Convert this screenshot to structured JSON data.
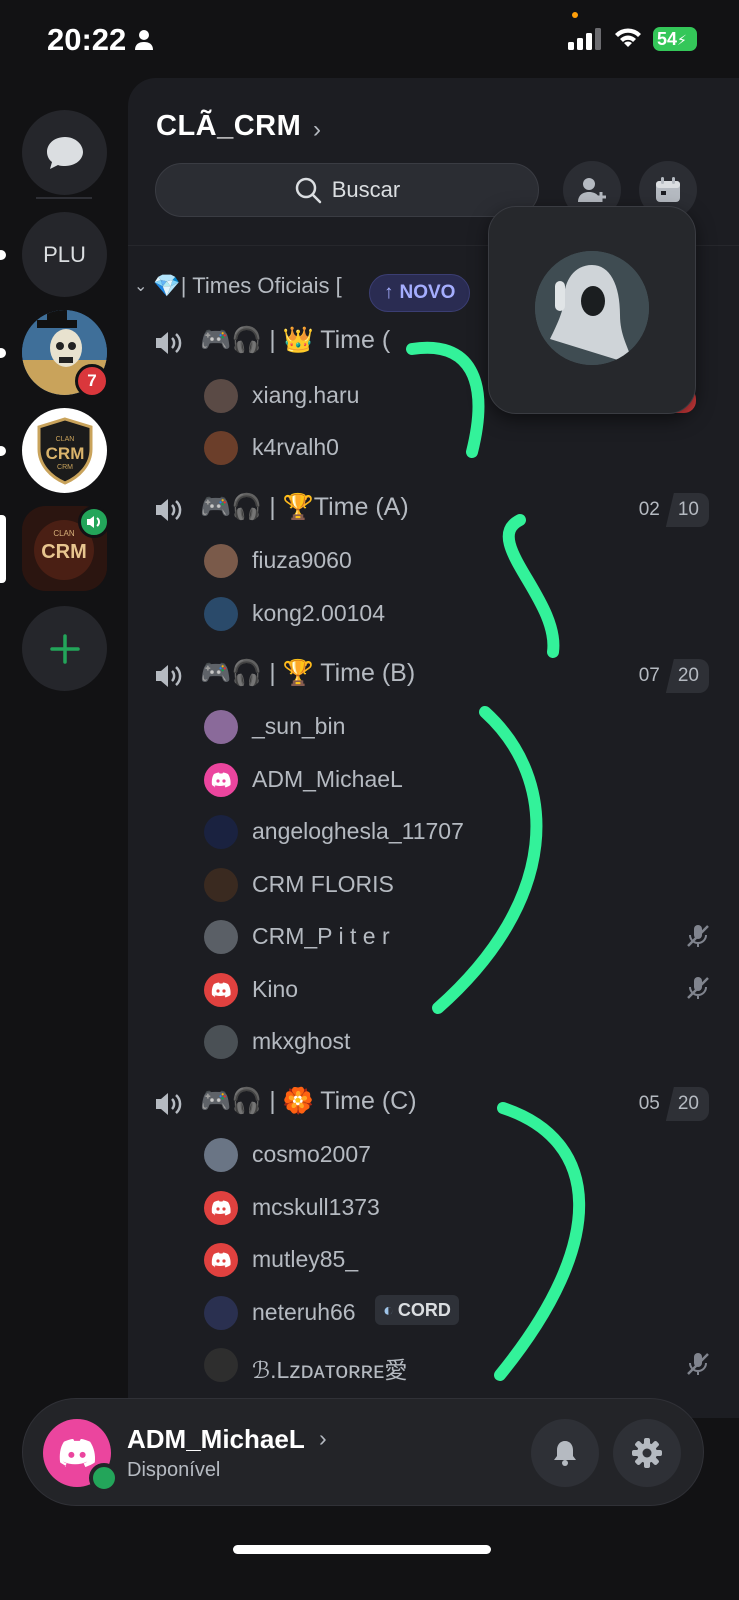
{
  "status_bar": {
    "time": "20:22",
    "battery": "54"
  },
  "rail": {
    "dm_label": "",
    "servers": [
      {
        "abbr": "PLU"
      },
      {
        "badge": "7"
      },
      {
        "logo_top": "CLAN",
        "logo_main": "CRM",
        "logo_bottom": "CRM"
      },
      {
        "logo_top": "CLAN",
        "logo_main": "CRM"
      }
    ]
  },
  "header": {
    "guild_name": "CLÃ_CRM",
    "search_placeholder": "Buscar"
  },
  "category": {
    "label": "💎| Times Oficiais [",
    "new_pill": "NOVO"
  },
  "channels": [
    {
      "label": "🎮🎧 | 👑 Time (",
      "users": [
        {
          "name": "xiang.haru"
        },
        {
          "name": "k4rvalh0"
        }
      ]
    },
    {
      "label": "🎮🎧 | 🏆Time (A)",
      "count": "02",
      "limit": "10",
      "users": [
        {
          "name": "fiuza9060"
        },
        {
          "name": "kong2.00104"
        }
      ]
    },
    {
      "label": "🎮🎧 | 🏆 Time (B)",
      "count": "07",
      "limit": "20",
      "users": [
        {
          "name": "_sun_bin"
        },
        {
          "name": "ADM_MichaeL"
        },
        {
          "name": "angeloghesla_11707"
        },
        {
          "name": "CRM  FLORIS"
        },
        {
          "name": "CRM_P i t e r"
        },
        {
          "name": "Kino"
        },
        {
          "name": "mkxghost"
        }
      ]
    },
    {
      "label": "🎮🎧 | 🏵️ Time (C)",
      "count": "05",
      "limit": "20",
      "users": [
        {
          "name": "cosmo2007"
        },
        {
          "name": "mcskull1373"
        },
        {
          "name": "mutley85_"
        },
        {
          "name": "neteruh66",
          "tag": "CORD"
        },
        {
          "name": "ℬ.Lᴢᴅᴀᴛᴏʀʀᴇ愛"
        }
      ]
    }
  ],
  "user_panel": {
    "name": "ADM_MichaeL",
    "status": "Disponível"
  },
  "colors": {
    "accent_green": "#23a55a",
    "discord_red": "#e0413f",
    "discord_pink": "#eb459e",
    "annotation": "#33f29a"
  }
}
